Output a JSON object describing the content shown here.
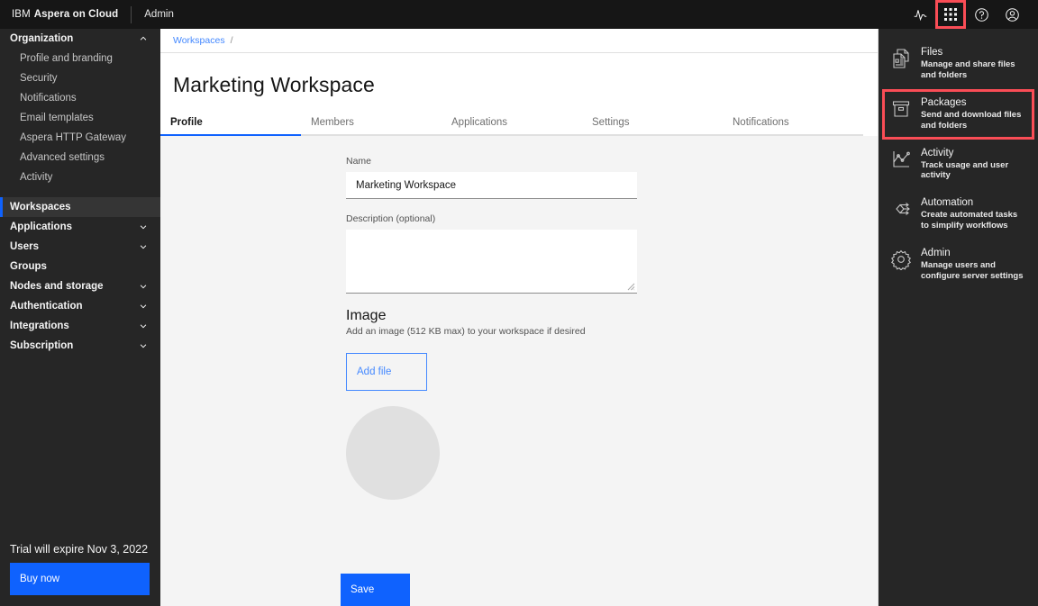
{
  "header": {
    "brand_ibm": "IBM",
    "brand_product": "Aspera on Cloud",
    "brand_section": "Admin",
    "icons": [
      {
        "name": "activity-pulse-icon",
        "label": "Activity",
        "highlighted": false
      },
      {
        "name": "app-switcher-grid-icon",
        "label": "App switcher",
        "highlighted": true
      },
      {
        "name": "help-icon",
        "label": "Help",
        "highlighted": false
      },
      {
        "name": "user-avatar-icon",
        "label": "Account",
        "highlighted": false
      }
    ]
  },
  "sidebar": {
    "groups": [
      {
        "label": "Organization",
        "expandable": true,
        "expanded": true,
        "selected": false,
        "sub": false
      },
      {
        "label": "Profile and branding",
        "expandable": false,
        "expanded": false,
        "selected": false,
        "sub": true
      },
      {
        "label": "Security",
        "expandable": false,
        "expanded": false,
        "selected": false,
        "sub": true
      },
      {
        "label": "Notifications",
        "expandable": false,
        "expanded": false,
        "selected": false,
        "sub": true
      },
      {
        "label": "Email templates",
        "expandable": false,
        "expanded": false,
        "selected": false,
        "sub": true
      },
      {
        "label": "Aspera HTTP Gateway",
        "expandable": false,
        "expanded": false,
        "selected": false,
        "sub": true
      },
      {
        "label": "Advanced settings",
        "expandable": false,
        "expanded": false,
        "selected": false,
        "sub": true
      },
      {
        "label": "Activity",
        "expandable": false,
        "expanded": false,
        "selected": false,
        "sub": true
      },
      {
        "label": "Workspaces",
        "expandable": false,
        "expanded": false,
        "selected": true,
        "sub": false
      },
      {
        "label": "Applications",
        "expandable": true,
        "expanded": false,
        "selected": false,
        "sub": false
      },
      {
        "label": "Users",
        "expandable": true,
        "expanded": false,
        "selected": false,
        "sub": false
      },
      {
        "label": "Groups",
        "expandable": false,
        "expanded": false,
        "selected": false,
        "sub": false
      },
      {
        "label": "Nodes and storage",
        "expandable": true,
        "expanded": false,
        "selected": false,
        "sub": false
      },
      {
        "label": "Authentication",
        "expandable": true,
        "expanded": false,
        "selected": false,
        "sub": false
      },
      {
        "label": "Integrations",
        "expandable": true,
        "expanded": false,
        "selected": false,
        "sub": false
      },
      {
        "label": "Subscription",
        "expandable": true,
        "expanded": false,
        "selected": false,
        "sub": false
      }
    ],
    "trial_text": "Trial will expire Nov 3, 2022",
    "buy_now_label": "Buy now"
  },
  "breadcrumb": {
    "link": "Workspaces",
    "separator": "/"
  },
  "page": {
    "title": "Marketing Workspace"
  },
  "tabs": [
    {
      "label": "Profile",
      "active": true
    },
    {
      "label": "Members",
      "active": false
    },
    {
      "label": "Applications",
      "active": false
    },
    {
      "label": "Settings",
      "active": false
    },
    {
      "label": "Notifications",
      "active": false
    }
  ],
  "form": {
    "name_label": "Name",
    "name_value": "Marketing Workspace",
    "name_placeholder": "",
    "description_label": "Description (optional)",
    "description_value": "",
    "description_placeholder": "",
    "image_heading": "Image",
    "image_subtext": "Add an image (512 KB max) to your workspace if desired",
    "add_file_label": "Add file",
    "save_label": "Save"
  },
  "app_panel": {
    "entries": [
      {
        "icon": "files-document-icon",
        "name": "Files",
        "desc": "Manage and share files and folders",
        "highlighted": false
      },
      {
        "icon": "packages-box-icon",
        "name": "Packages",
        "desc": "Send and download files and folders",
        "highlighted": true
      },
      {
        "icon": "activity-chart-icon",
        "name": "Activity",
        "desc": "Track usage and user activity",
        "highlighted": false
      },
      {
        "icon": "automation-workflow-icon",
        "name": "Automation",
        "desc": "Create automated tasks to simplify workflows",
        "highlighted": false
      },
      {
        "icon": "admin-gear-icon",
        "name": "Admin",
        "desc": "Manage users and configure server settings",
        "highlighted": false
      }
    ]
  },
  "colors": {
    "accent_blue": "#0f62fe",
    "link_blue": "#4589ff",
    "highlight_red": "#fa4d56",
    "dark_nav": "#262626",
    "header_black": "#161616",
    "page_bg": "#f4f4f4"
  }
}
